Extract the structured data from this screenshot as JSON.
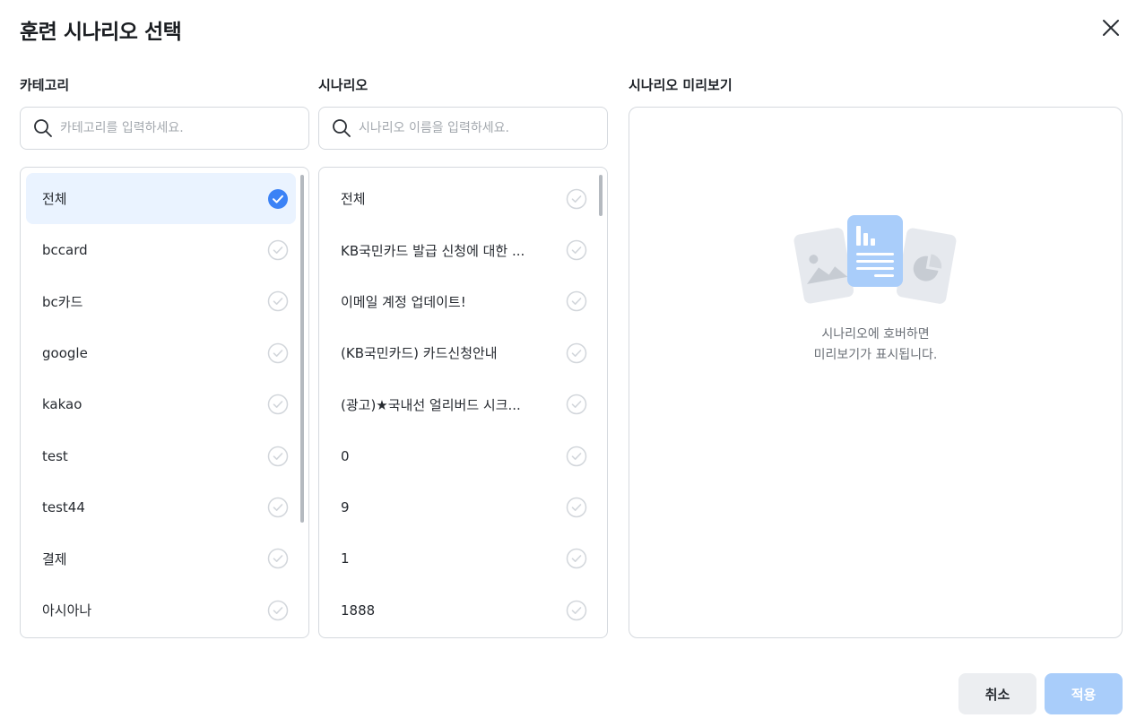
{
  "modal": {
    "title": "훈련 시나리오 선택"
  },
  "category": {
    "label": "카테고리",
    "search_placeholder": "카테고리를 입력하세요.",
    "items": [
      {
        "label": "전체",
        "selected": true
      },
      {
        "label": "bccard",
        "selected": false
      },
      {
        "label": "bc카드",
        "selected": false
      },
      {
        "label": "google",
        "selected": false
      },
      {
        "label": "kakao",
        "selected": false
      },
      {
        "label": "test",
        "selected": false
      },
      {
        "label": "test44",
        "selected": false
      },
      {
        "label": "결제",
        "selected": false
      },
      {
        "label": "아시아나",
        "selected": false
      }
    ]
  },
  "scenario": {
    "label": "시나리오",
    "search_placeholder": "시나리오 이름을 입력하세요.",
    "items": [
      {
        "label": "전체",
        "selected": false
      },
      {
        "label": "KB국민카드 발급 신청에 대한 ...",
        "selected": false
      },
      {
        "label": "이메일 계정 업데이트!",
        "selected": false
      },
      {
        "label": "(KB국민카드) 카드신청안내",
        "selected": false
      },
      {
        "label": "(광고)★국내선 얼리버드 시크...",
        "selected": false
      },
      {
        "label": "0",
        "selected": false
      },
      {
        "label": "9",
        "selected": false
      },
      {
        "label": "1",
        "selected": false
      },
      {
        "label": "1888",
        "selected": false
      }
    ]
  },
  "preview": {
    "label": "시나리오 미리보기",
    "empty_line1": "시나리오에 호버하면",
    "empty_line2": "미리보기가 표시됩니다."
  },
  "footer": {
    "cancel_label": "취소",
    "apply_label": "적용"
  },
  "icons": {
    "close": "close-icon",
    "search": "search-icon",
    "check": "check-circle-icon",
    "preview": "document-preview-icon"
  },
  "colors": {
    "accent": "#3b82f6",
    "selected_bg": "#eaf3ff",
    "apply_disabled": "#a9cdfa",
    "cancel_bg": "#eceef1",
    "border": "#d5d9de"
  }
}
